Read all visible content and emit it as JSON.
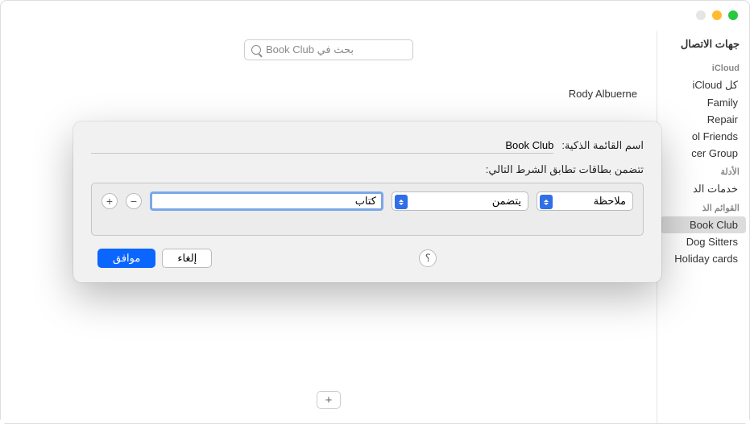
{
  "header": {
    "title": "جهات الاتصال"
  },
  "search": {
    "placeholder": "بحث في Book Club"
  },
  "contact": {
    "name": "Rody Albuerne"
  },
  "sidebar": {
    "section1_heading": "iCloud",
    "section1_items": [
      "كل iCloud",
      "Family",
      "Repair",
      "ol Friends",
      "cer Group"
    ],
    "section2_heading": "الأدلة",
    "section2_items": [
      "خدمات الد"
    ],
    "section3_heading": "القوائم الذ",
    "section3_items": [
      "Book Club",
      "Dog Sitters",
      "Holiday cards"
    ],
    "selected": "Book Club"
  },
  "dialog": {
    "name_label": "اسم القائمة الذكية:",
    "name_value": "Book Club",
    "subtitle": "تتضمن بطاقات تطابق الشرط التالي:",
    "rule": {
      "field": "ملاحظة",
      "operator": "يتضمن",
      "value": "كتاب"
    },
    "buttons": {
      "ok": "موافق",
      "cancel": "إلغاء",
      "help": "؟",
      "add": "+",
      "remove": "−"
    }
  },
  "add_icon": "+"
}
